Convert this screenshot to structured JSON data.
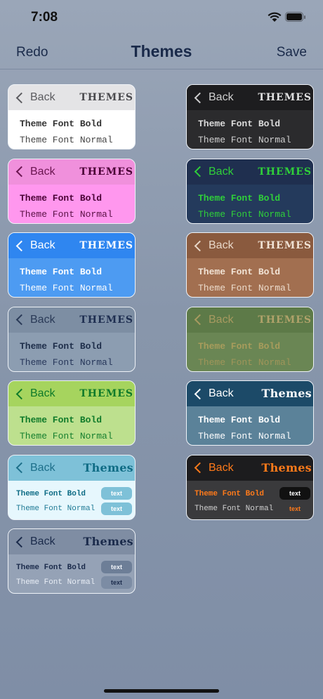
{
  "status": {
    "time": "7:08"
  },
  "nav": {
    "left": "Redo",
    "title": "Themes",
    "right": "Save"
  },
  "back_label": "Back",
  "bold_text": "Theme Font Bold",
  "normal_text": "Theme Font Normal",
  "pill_text": "text",
  "cards": [
    {
      "id": "light",
      "title": "THEMES",
      "hdr": "#e4e4e6",
      "body": "#ffffff",
      "back": "#5c5c60",
      "ttl": "#4a4a4e",
      "bold": "#333",
      "norm": "#444"
    },
    {
      "id": "dark",
      "title": "THEMES",
      "hdr": "#1d1d1f",
      "body": "#2b2b2d",
      "back": "#cfcfcf",
      "ttl": "#e0e0e0",
      "bold": "#dcdcdc",
      "norm": "#cfcfcf"
    },
    {
      "id": "pink",
      "title": "THEMES",
      "hdr": "#f090dc",
      "body": "#ff97ee",
      "back": "#6a1550",
      "ttl": "#4a0035",
      "bold": "#4a0035",
      "norm": "#5a1045"
    },
    {
      "id": "navy-green",
      "title": "THEMES",
      "hdr": "#1f2f4f",
      "body": "#243a5c",
      "back": "#2fcf3a",
      "ttl": "#2fcf3a",
      "bold": "#2fcf3a",
      "norm": "#2fcf3a"
    },
    {
      "id": "blue",
      "title": "THEMES",
      "hdr": "#2f86f0",
      "body": "#4d9bf2",
      "back": "#ffffff",
      "ttl": "#ffffff",
      "bold": "#ffffff",
      "norm": "#ffffff"
    },
    {
      "id": "brown",
      "title": "THEMES",
      "hdr": "#8a5a3e",
      "body": "#a26f50",
      "back": "#e8d7c8",
      "ttl": "#f0e2d4",
      "bold": "#f2e4d6",
      "norm": "#ecdccc"
    },
    {
      "id": "slate",
      "title": "THEMES",
      "hdr": "#7d8ea3",
      "body": "#8c9db1",
      "back": "#2a3a57",
      "ttl": "#1e2e50",
      "bold": "#1e2e4a",
      "norm": "#27375a"
    },
    {
      "id": "olive",
      "title": "THEMES",
      "hdr": "#5d7a48",
      "body": "#6a8654",
      "back": "#a89a60",
      "ttl": "#b0a26a",
      "bold": "#a89c5c",
      "norm": "#a0955a"
    },
    {
      "id": "lime",
      "title": "THEMES",
      "hdr": "#a6d45e",
      "body": "#bde08e",
      "back": "#0f7a2a",
      "ttl": "#0f7a2a",
      "bold": "#0f7a2a",
      "norm": "#167f2f"
    },
    {
      "id": "teal-dark",
      "title": "Themes",
      "hdr": "#1c4a68",
      "body": "#5b8299",
      "back": "#ffffff",
      "ttl": "#ffffff",
      "bold": "#ffffff",
      "norm": "#ffffff"
    },
    {
      "id": "cyan",
      "title": "Themes",
      "hdr": "#7ec1d8",
      "body": "#e6f7fd",
      "back": "#1d6f8a",
      "ttl": "#0f6c85",
      "bold": "#0f6c85",
      "norm": "#1f7a95",
      "pill_bg": "#7ec1d8",
      "pill_fg": "#ffffff"
    },
    {
      "id": "black-orange",
      "title": "Themes",
      "hdr": "#1c1c1e",
      "body": "#3a3a3c",
      "back": "#ff7a1a",
      "ttl": "#ff7a1a",
      "bold": "#ff7a1a",
      "norm": "#cfcfcf",
      "pill_bg": "#111111",
      "pill_fg": "#ffffff",
      "pill2_bg": "transparent",
      "pill2_fg": "#ff7a1a"
    },
    {
      "id": "gray-navy",
      "title": "Themes",
      "hdr": "#7f8da3",
      "body": "#95a2b6",
      "back": "#1b2b4b",
      "ttl": "#1b2b4b",
      "bold": "#1b2b4b",
      "norm": "#e8edf5",
      "pill_bg": "#6d7e97",
      "pill_fg": "#f2f5fa",
      "pill2_bg": "#7c8ca4",
      "pill2_fg": "#1b2b4b"
    }
  ]
}
